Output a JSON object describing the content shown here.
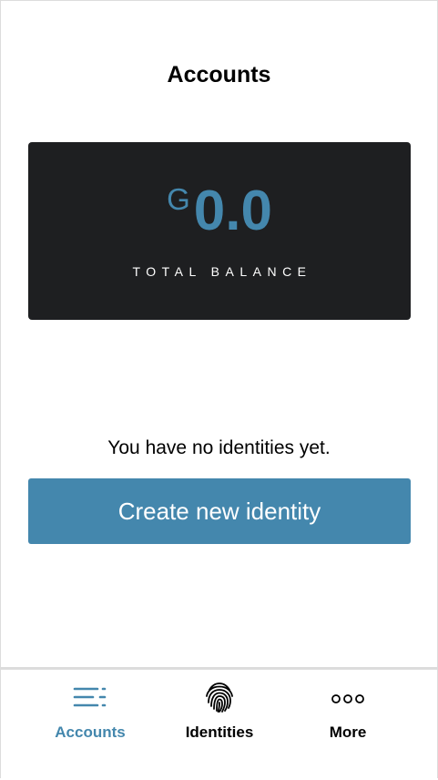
{
  "header": {
    "title": "Accounts"
  },
  "balance_card": {
    "currency_symbol": "G",
    "amount": "0.0",
    "label": "TOTAL BALANCE"
  },
  "identities": {
    "empty_message": "You have no identities yet.",
    "create_button_label": "Create new identity"
  },
  "bottom_nav": {
    "items": [
      {
        "label": "Accounts",
        "icon": "list-icon",
        "active": true
      },
      {
        "label": "Identities",
        "icon": "fingerprint-icon",
        "active": false
      },
      {
        "label": "More",
        "icon": "more-dots-icon",
        "active": false
      }
    ]
  },
  "colors": {
    "accent": "#4487ad",
    "card_background": "#1e1f21",
    "text": "#000000",
    "divider": "#dcdcdc"
  }
}
